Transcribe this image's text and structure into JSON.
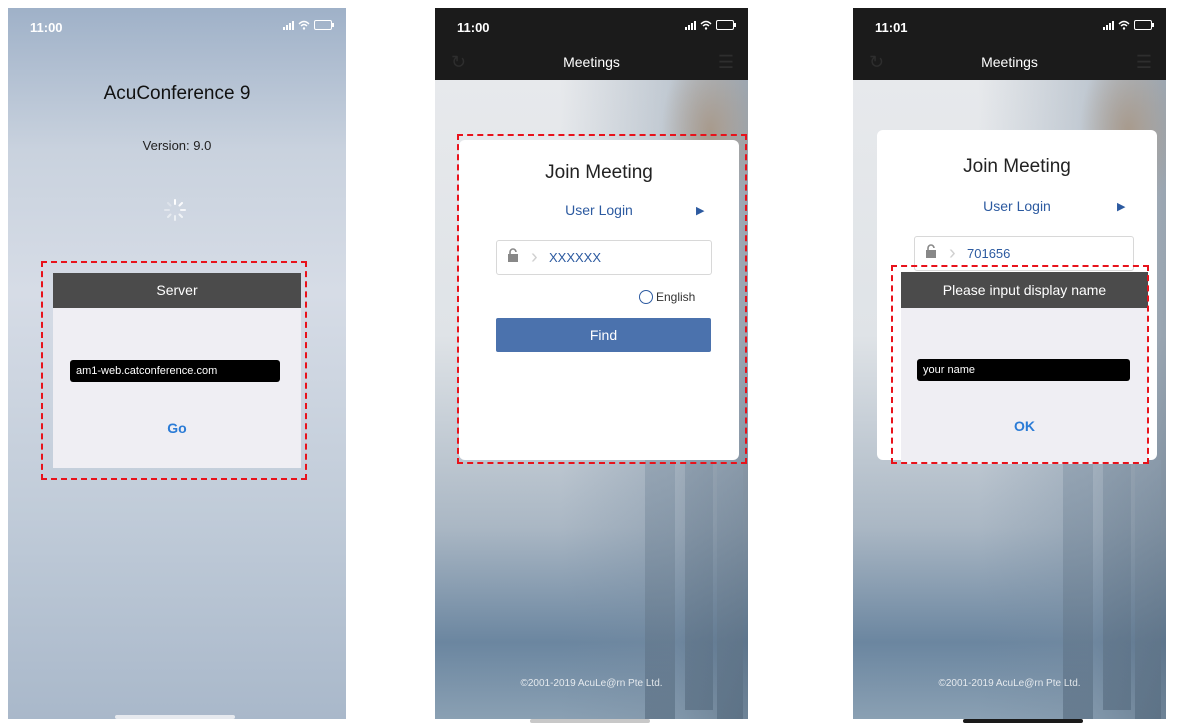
{
  "screens": [
    {
      "time": "11:00",
      "app_title": "AcuConference 9",
      "version": "Version: 9.0",
      "dialog": {
        "title": "Server",
        "input_value": "am1-web.catconference.com",
        "button": "Go"
      }
    },
    {
      "time": "11:00",
      "nav_title": "Meetings",
      "join": {
        "title": "Join Meeting",
        "user_login": "User Login",
        "meeting_id": "XXXXXX",
        "language": "English",
        "find": "Find"
      },
      "copyright": "©2001-2019 AcuLe@rn Pte Ltd."
    },
    {
      "time": "11:01",
      "nav_title": "Meetings",
      "join": {
        "title": "Join Meeting",
        "user_login": "User Login",
        "meeting_id": "701656"
      },
      "dialog": {
        "title": "Please input display name",
        "input_value": "your name",
        "button": "OK"
      },
      "copyright": "©2001-2019 AcuLe@rn Pte Ltd."
    }
  ],
  "colors": {
    "highlight": "#e8121b",
    "link": "#2c5aa0",
    "dialog_button": "#2a7bd6",
    "find_button": "#4b72ad"
  }
}
